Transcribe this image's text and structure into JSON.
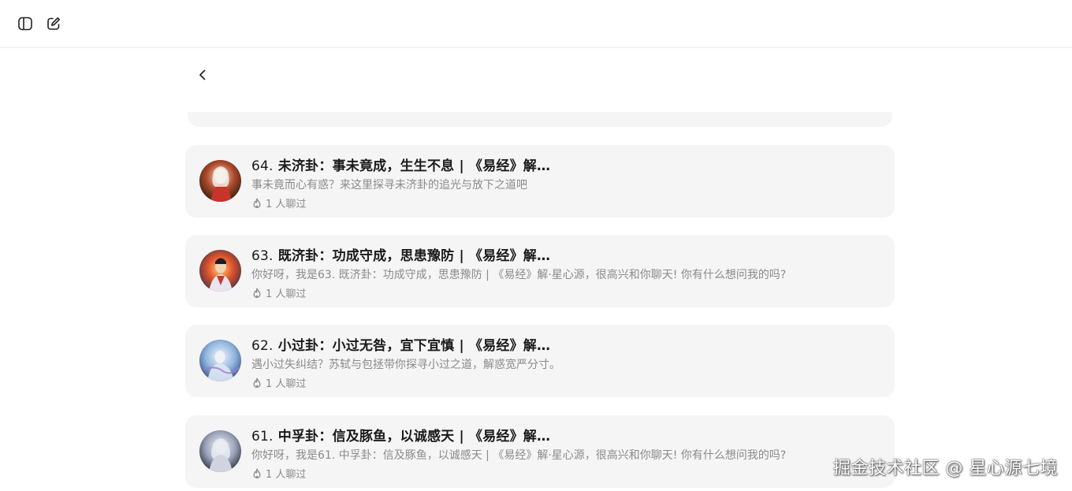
{
  "toolbar": {
    "sidebar_icon": "sidebar-toggle-icon",
    "new_chat_icon": "edit-icon"
  },
  "nav": {
    "back_icon": "chevron-left-icon"
  },
  "cards": [
    {
      "number": "64.",
      "title": "未济卦：事未竟成，生生不息 | 《易经》解…",
      "description": "事未竟而心有惑？来这里探寻未济卦的追光与放下之道吧",
      "meta": "1 人聊过",
      "avatar_colors": [
        "#c93a2b",
        "#e8d9c2",
        "#6b3b1f"
      ]
    },
    {
      "number": "63.",
      "title": "既济卦：功成守成，思患豫防 | 《易经》解…",
      "description": "你好呀，我是63. 既济卦：功成守成，思患豫防 | 《易经》解·星心源，很高兴和你聊天! 你有什么想问我的吗?",
      "meta": "1 人聊过",
      "avatar_colors": [
        "#d9482b",
        "#f4a341",
        "#3b3b5e"
      ]
    },
    {
      "number": "62.",
      "title": "小过卦：小过无咎，宜下宜慎 | 《易经》解…",
      "description": "遇小过失纠结？苏轼与包拯带你探寻小过之道，解惑宽严分寸。",
      "meta": "1 人聊过",
      "avatar_colors": [
        "#7fa8d6",
        "#e6eef7",
        "#3c5a8f"
      ]
    },
    {
      "number": "61.",
      "title": "中孚卦：信及豚鱼，以诚感天 | 《易经》解…",
      "description": "你好呀，我是61. 中孚卦：信及豚鱼，以诚感天 | 《易经》解·星心源，很高兴和你聊天! 你有什么想问我的吗?",
      "meta": "1 人聊过",
      "avatar_colors": [
        "#9aa3b8",
        "#eef0f5",
        "#2f3345"
      ]
    }
  ],
  "watermark": "掘金技术社区 @ 星心源七境"
}
